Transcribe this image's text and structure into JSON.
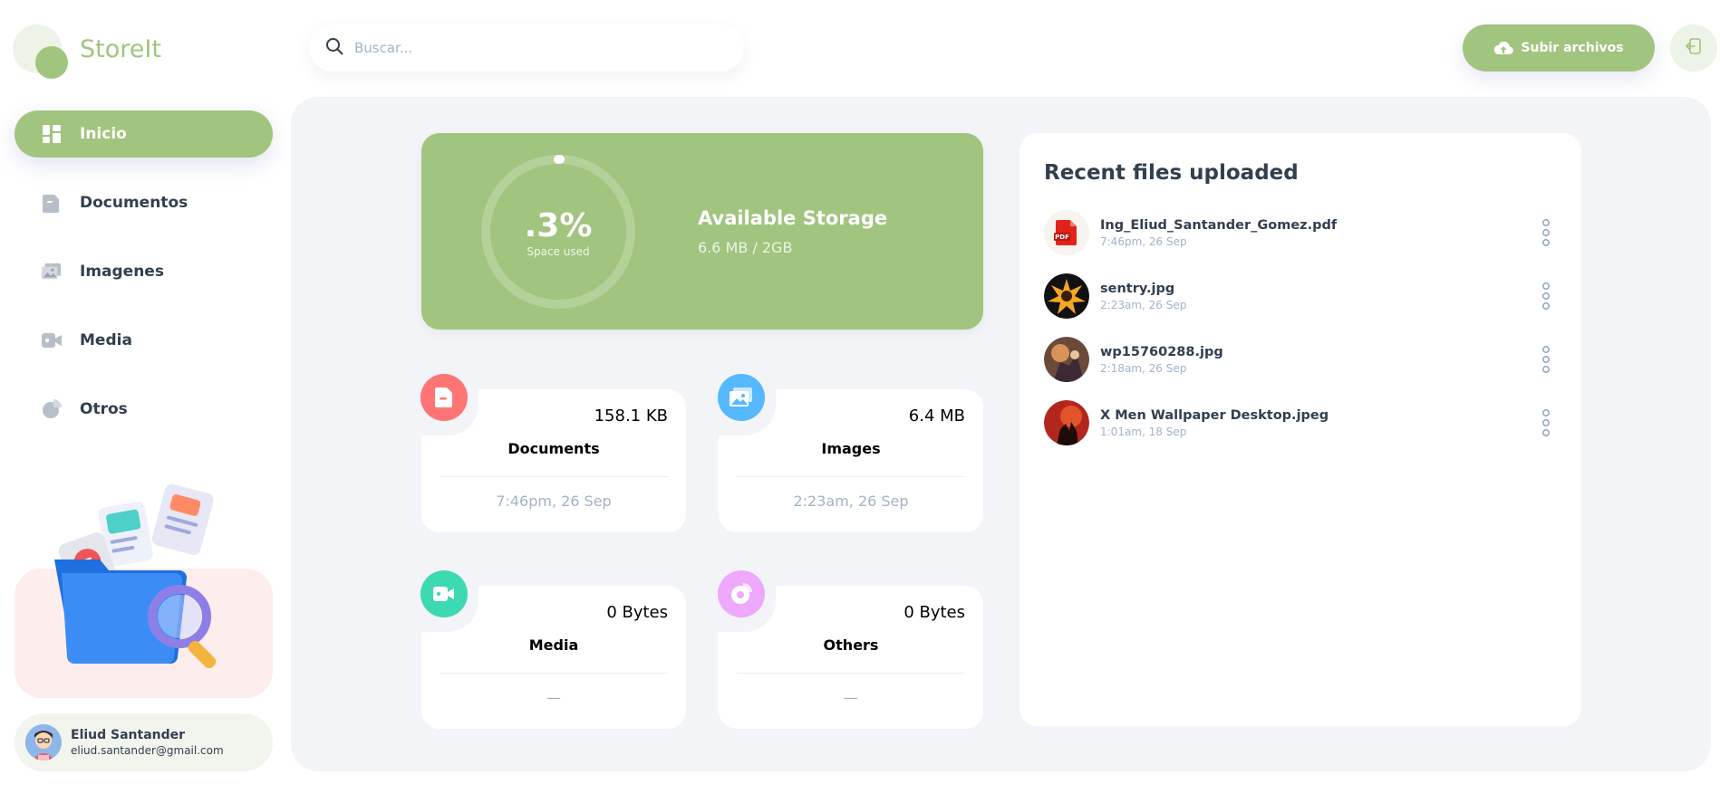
{
  "app": {
    "brand": "StoreIt"
  },
  "sidebar": {
    "items": [
      {
        "label": "Inicio",
        "icon": "dashboard-icon",
        "active": true
      },
      {
        "label": "Documentos",
        "icon": "documents-icon",
        "active": false
      },
      {
        "label": "Imagenes",
        "icon": "images-icon",
        "active": false
      },
      {
        "label": "Media",
        "icon": "video-icon",
        "active": false
      },
      {
        "label": "Otros",
        "icon": "pie-chart-icon",
        "active": false
      }
    ],
    "user": {
      "name": "Eliud Santander",
      "email": "eliud.santander@gmail.com"
    }
  },
  "header": {
    "search_placeholder": "Buscar...",
    "upload_label": "Subir archivos"
  },
  "storage": {
    "percent_label": ".3%",
    "percent_sub": "Space used",
    "percent_value": 0.3,
    "title": "Available Storage",
    "size": "6.6 MB / 2GB"
  },
  "summary": [
    {
      "name": "Documents",
      "size": "158.1 KB",
      "date": "7:46pm, 26 Sep",
      "color": "#FF7474",
      "icon": "document-icon"
    },
    {
      "name": "Images",
      "size": "6.4 MB",
      "date": "2:23am, 26 Sep",
      "color": "#56B8FF",
      "icon": "image-icon"
    },
    {
      "name": "Media",
      "size": "0 Bytes",
      "date": "—",
      "color": "#3DD9B3",
      "icon": "video-icon"
    },
    {
      "name": "Others",
      "size": "0 Bytes",
      "date": "—",
      "color": "#EEA8FD",
      "icon": "pie-chart-icon"
    }
  ],
  "recent": {
    "title": "Recent files uploaded",
    "files": [
      {
        "name": "Ing_Eliud_Santander_Gomez.pdf",
        "date": "7:46pm, 26 Sep",
        "thumb": "pdf-icon"
      },
      {
        "name": "sentry.jpg",
        "date": "2:23am, 26 Sep",
        "thumb": "image-thumbnail"
      },
      {
        "name": "wp15760288.jpg",
        "date": "2:18am, 26 Sep",
        "thumb": "image-thumbnail"
      },
      {
        "name": "X Men Wallpaper Desktop.jpeg",
        "date": "1:01am, 18 Sep",
        "thumb": "image-thumbnail"
      }
    ]
  },
  "colors": {
    "brand": "#A1C47E",
    "text": "#333F4E",
    "muted": "#A3B2C7",
    "main_bg": "#F2F4F8"
  }
}
